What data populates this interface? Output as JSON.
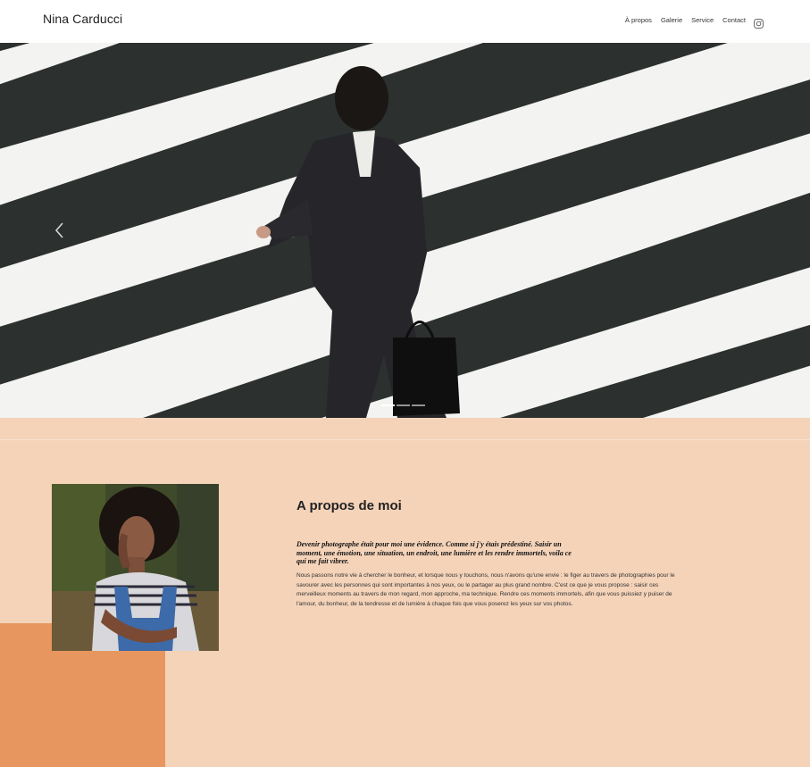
{
  "header": {
    "brand": "Nina Carducci",
    "nav": {
      "about": "À propos",
      "gallery": "Galerie",
      "service": "Service",
      "contact": "Contact"
    },
    "social_icon": "instagram-icon"
  },
  "hero": {
    "prev_icon": "chevron-left-icon",
    "indicators": 3,
    "active_indicator": 1
  },
  "about": {
    "title": "A propos de moi",
    "lead": "Devenir photographe était pour moi une évidence. Comme si j'y étais prédestiné. Saisir un moment, une émotion, une situation, un endroit, une lumière et les rendre immortels, voila ce qui me fait vibrer.",
    "body": "Nous passons notre vie à chercher le bonheur, et lorsque nous y touchons, nous n'avons qu'une envie : le figer au travers de photographies pour le savourer avec les personnes qui sont importantes à nos yeux, ou le partager au plus grand nombre. C'est ce que je vous propose : saisir ces merveilleux moments au travers de mon regard, mon approche, ma technique. Rendre ces moments immortels, afin que vous puissiez y puiser de l'amour, du bonheur, de la tendresse et de lumière à chaque fois que vous poserez les yeux sur vos photos."
  },
  "colors": {
    "peach": "#f4d3b9",
    "accent": "#e6965e"
  }
}
